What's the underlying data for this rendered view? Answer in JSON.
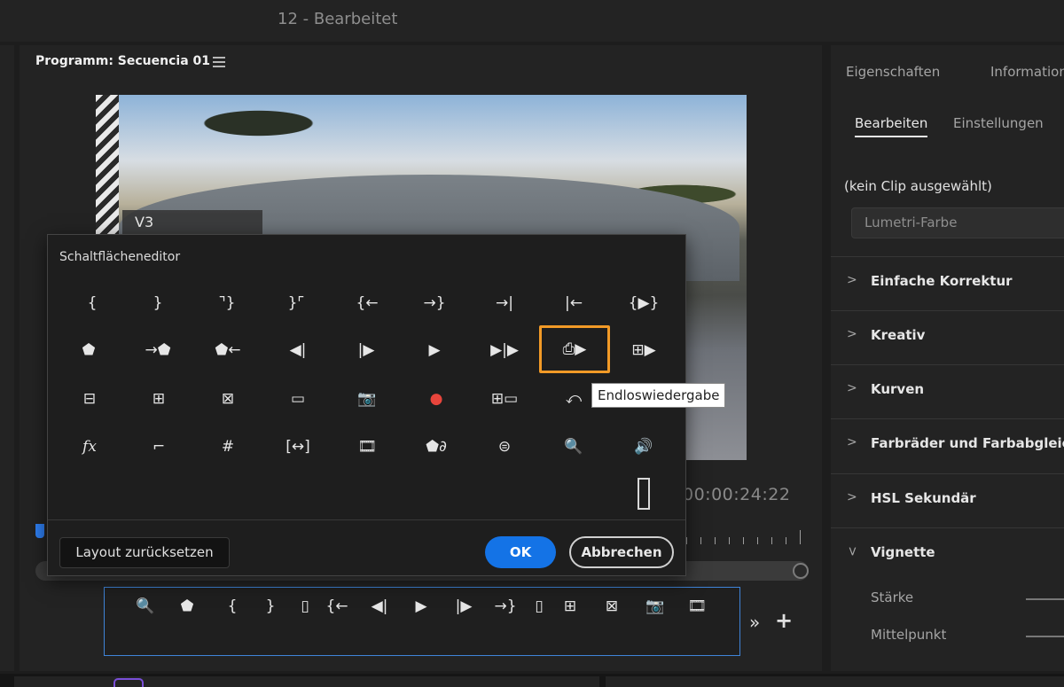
{
  "window": {
    "title": "12 - Bearbeitet"
  },
  "program_monitor": {
    "title": "Programm: Secuencia 01",
    "video_track_label": "V3",
    "timecode": "00:00:24:22"
  },
  "button_editor": {
    "title": "Schaltflächeneditor",
    "rows": [
      [
        "{",
        "}",
        "⌝}",
        "}⌜",
        "{←",
        "→}",
        "→|",
        "|←",
        "{▶}"
      ],
      [
        "⬟",
        "→⬟",
        "⬟←",
        "◀|",
        "|▶",
        "▶",
        "▶|▶",
        "⎙▶",
        "⊞▶"
      ],
      [
        "⊟",
        "⊞",
        "⊠",
        "▭",
        "📷",
        "●",
        "⊞▭",
        "⤺"
      ],
      [
        "fx",
        "⌐",
        "#",
        "[↔]",
        "🎞",
        "⬟∂",
        "⊜",
        "🔍",
        "🔊"
      ]
    ],
    "selected_button": "Endloswiedergabe",
    "tooltip": "Endloswiedergabe",
    "reset_label": "Layout zurücksetzen",
    "ok_label": "OK",
    "cancel_label": "Abbrechen"
  },
  "button_bar": {
    "icons": [
      "🔍",
      "⬟",
      "{",
      "}",
      "▯",
      "{←",
      "◀|",
      "▶",
      "|▶",
      "→}",
      "▯",
      "⊞",
      "⊠",
      "📷",
      "🎞"
    ],
    "overflow_label": "»",
    "add_label": "+"
  },
  "properties_panel": {
    "tabs": [
      "Eigenschaften",
      "Informationen"
    ],
    "subtabs": [
      "Bearbeiten",
      "Einstellungen"
    ],
    "no_clip_label": "(kein Clip ausgewählt)",
    "effect_dropdown": "Lumetri-Farbe",
    "sections": [
      "Einfache Korrektur",
      "Kreativ",
      "Kurven",
      "Farbräder und Farbabgleich",
      "HSL Sekundär",
      "Vignette"
    ],
    "vignette_params": [
      "Stärke",
      "Mittelpunkt"
    ]
  },
  "colors": {
    "accent_blue": "#1473e6",
    "selection_orange": "#f29a27",
    "record_red": "#e8453c"
  }
}
